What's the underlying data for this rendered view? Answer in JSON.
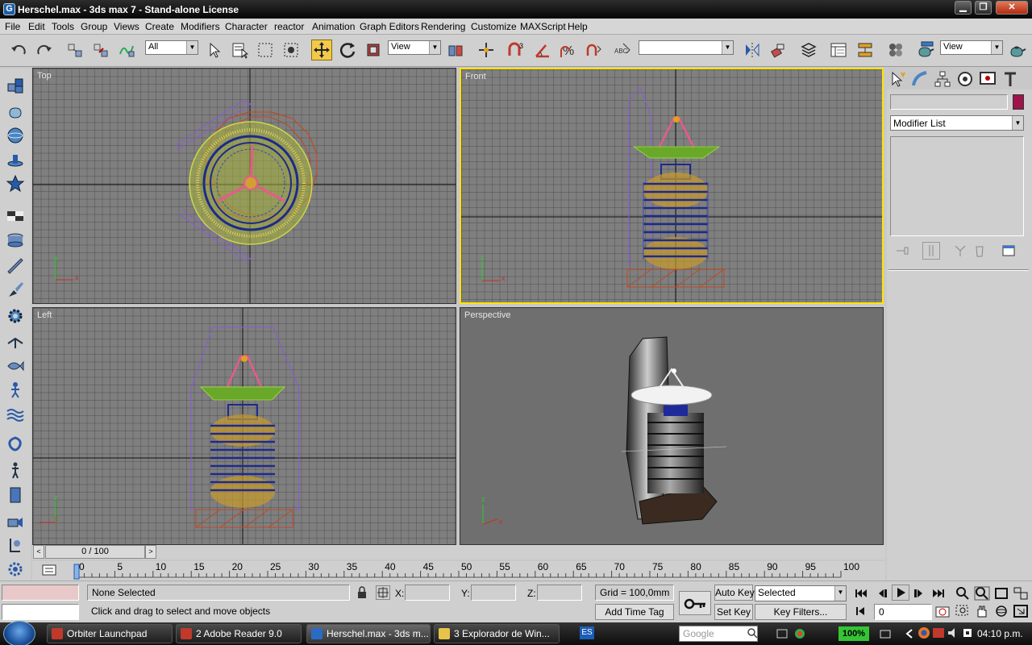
{
  "window": {
    "title": "Herschel.max - 3ds max 7  - Stand-alone License",
    "app_icon_glyph": "G"
  },
  "menu": [
    "File",
    "Edit",
    "Tools",
    "Group",
    "Views",
    "Create",
    "Modifiers",
    "Character",
    "reactor",
    "Animation",
    "Graph Editors",
    "Rendering",
    "Customize",
    "MAXScript",
    "Help"
  ],
  "toolbar": {
    "selection_filter": "All",
    "ref_coord": "View",
    "named_selection": "",
    "render_type": "View"
  },
  "viewports": {
    "top": "Top",
    "front": "Front",
    "left": "Left",
    "perspective": "Perspective",
    "axis_x": "x",
    "axis_y": "y",
    "axis_z": "z"
  },
  "command_panel": {
    "object_name": "",
    "modifier_list": "Modifier List",
    "color": "#a0134a"
  },
  "timeline": {
    "slider_label": "0 / 100",
    "frame": 0,
    "total": 100,
    "ticks": [
      0,
      5,
      10,
      15,
      20,
      25,
      30,
      35,
      40,
      45,
      50,
      55,
      60,
      65,
      70,
      75,
      80,
      85,
      90,
      95,
      100
    ]
  },
  "status": {
    "selection": "None Selected",
    "prompt": "Click and drag to select and move objects",
    "x_label": "X:",
    "y_label": "Y:",
    "z_label": "Z:",
    "x_value": "",
    "y_value": "",
    "z_value": "",
    "grid": "Grid = 100,0mm",
    "add_time_tag": "Add Time Tag",
    "auto_key": "Auto Key",
    "set_key": "Set Key",
    "key_mode": "Selected",
    "key_filters": "Key Filters...",
    "current_frame": "0"
  },
  "taskbar": {
    "items": [
      {
        "label": "Orbiter Launchpad",
        "color": "#c0392b"
      },
      {
        "label": "2 Adobe Reader 9.0",
        "color": "#c0392b"
      },
      {
        "label": "Herschel.max - 3ds m...",
        "color": "#2a6bc4"
      },
      {
        "label": "3 Explorador de Win...",
        "color": "#e8c34a"
      }
    ],
    "language": "ES",
    "search_placeholder": "Google",
    "battery": "100%",
    "clock": "04:10 p.m."
  }
}
